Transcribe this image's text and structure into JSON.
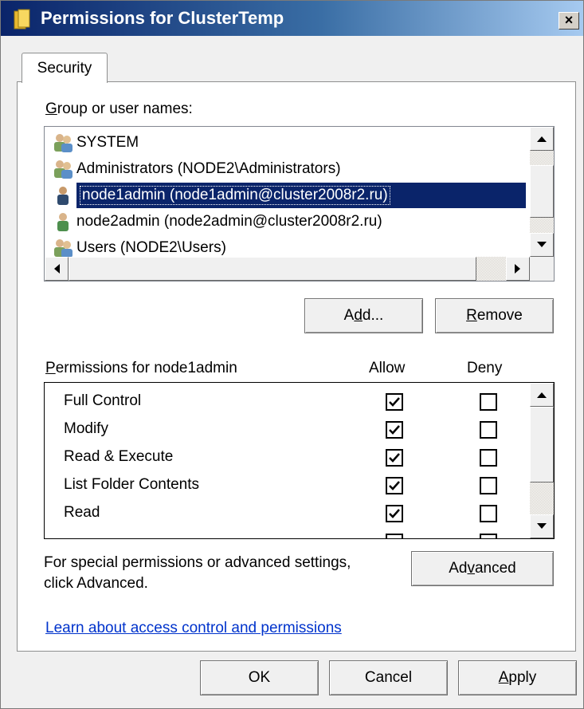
{
  "window": {
    "title": "Permissions for ClusterTemp",
    "close_glyph": "×"
  },
  "tabs": [
    {
      "label": "Security",
      "selected": true
    }
  ],
  "group_section": {
    "label": "Group or user names:",
    "label_accel": "G",
    "label_rest": "roup or user names:",
    "items": [
      {
        "name": "SYSTEM",
        "icon": "group-users-icon",
        "selected": false
      },
      {
        "name": "Administrators (NODE2\\Administrators)",
        "icon": "group-users-icon",
        "selected": false
      },
      {
        "name": "node1admin (node1admin@cluster2008r2.ru)",
        "icon": "user-icon",
        "selected": true
      },
      {
        "name": "node2admin (node2admin@cluster2008r2.ru)",
        "icon": "user-icon",
        "selected": false
      },
      {
        "name": "Users (NODE2\\Users)",
        "icon": "group-users-icon",
        "selected": false
      }
    ]
  },
  "buttons": {
    "add": {
      "pre": "A",
      "accel": "d",
      "post": "d..."
    },
    "remove": {
      "pre": "",
      "accel": "R",
      "post": "emove"
    },
    "advanced": {
      "pre": "Ad",
      "accel": "v",
      "post": "anced"
    },
    "ok": "OK",
    "cancel": "Cancel",
    "apply": {
      "pre": "",
      "accel": "A",
      "post": "pply"
    }
  },
  "permissions_section": {
    "label_accel": "P",
    "label_rest": "ermissions for node1admin",
    "allow_header": "Allow",
    "deny_header": "Deny",
    "rows": [
      {
        "name": "Full Control",
        "allow": true,
        "deny": false
      },
      {
        "name": "Modify",
        "allow": true,
        "deny": false
      },
      {
        "name": "Read & Execute",
        "allow": true,
        "deny": false
      },
      {
        "name": "List Folder Contents",
        "allow": true,
        "deny": false
      },
      {
        "name": "Read",
        "allow": true,
        "deny": false
      }
    ]
  },
  "advanced_note": {
    "line1": "For special permissions or advanced settings,",
    "line2": "click Advanced."
  },
  "help_link": "Learn about access control and permissions",
  "colors": {
    "selection": "#0a246a",
    "link": "#0033cc",
    "titlebar_start": "#0a246a",
    "titlebar_end": "#a6caf0"
  }
}
